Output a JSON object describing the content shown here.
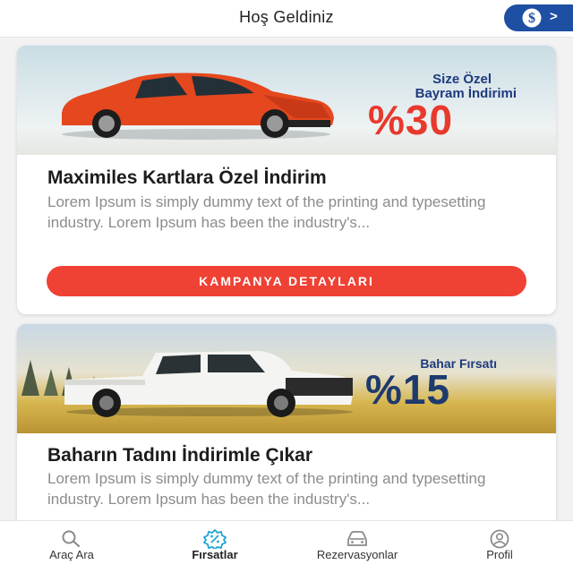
{
  "header": {
    "title": "Hoş Geldiniz",
    "right_chevron": ">",
    "bank_logo_icon": "isbank-logo-icon"
  },
  "campaigns": [
    {
      "banner": {
        "promo_line1": "Size Özel",
        "promo_line2": "Bayram İndirimi",
        "discount": "%30",
        "car_icon": "red-hatchback-car-image"
      },
      "title": "Maximiles Kartlara Özel İndirim",
      "description": "Lorem Ipsum is simply dummy text of the printing and typesetting industry. Lorem Ipsum has been the industry's...",
      "button_label": "KAMPANYA DETAYLARI"
    },
    {
      "banner": {
        "promo_line1": "Bahar Fırsatı",
        "discount": "%15",
        "car_icon": "white-pickup-truck-image"
      },
      "title": "Baharın Tadını İndirimle Çıkar",
      "description": "Lorem Ipsum is simply dummy text of the printing and typesetting industry. Lorem Ipsum has been the industry's..."
    }
  ],
  "bottom_nav": [
    {
      "label": "Araç Ara",
      "icon": "search-icon"
    },
    {
      "label": "Fırsatlar",
      "icon": "discount-badge-icon",
      "active": true
    },
    {
      "label": "Rezervasyonlar",
      "icon": "car-icon"
    },
    {
      "label": "Profil",
      "icon": "profile-icon"
    }
  ],
  "colors": {
    "accent_red": "#ef4134",
    "brand_blue": "#1d4fa3",
    "active_icon": "#1fa3d6"
  }
}
